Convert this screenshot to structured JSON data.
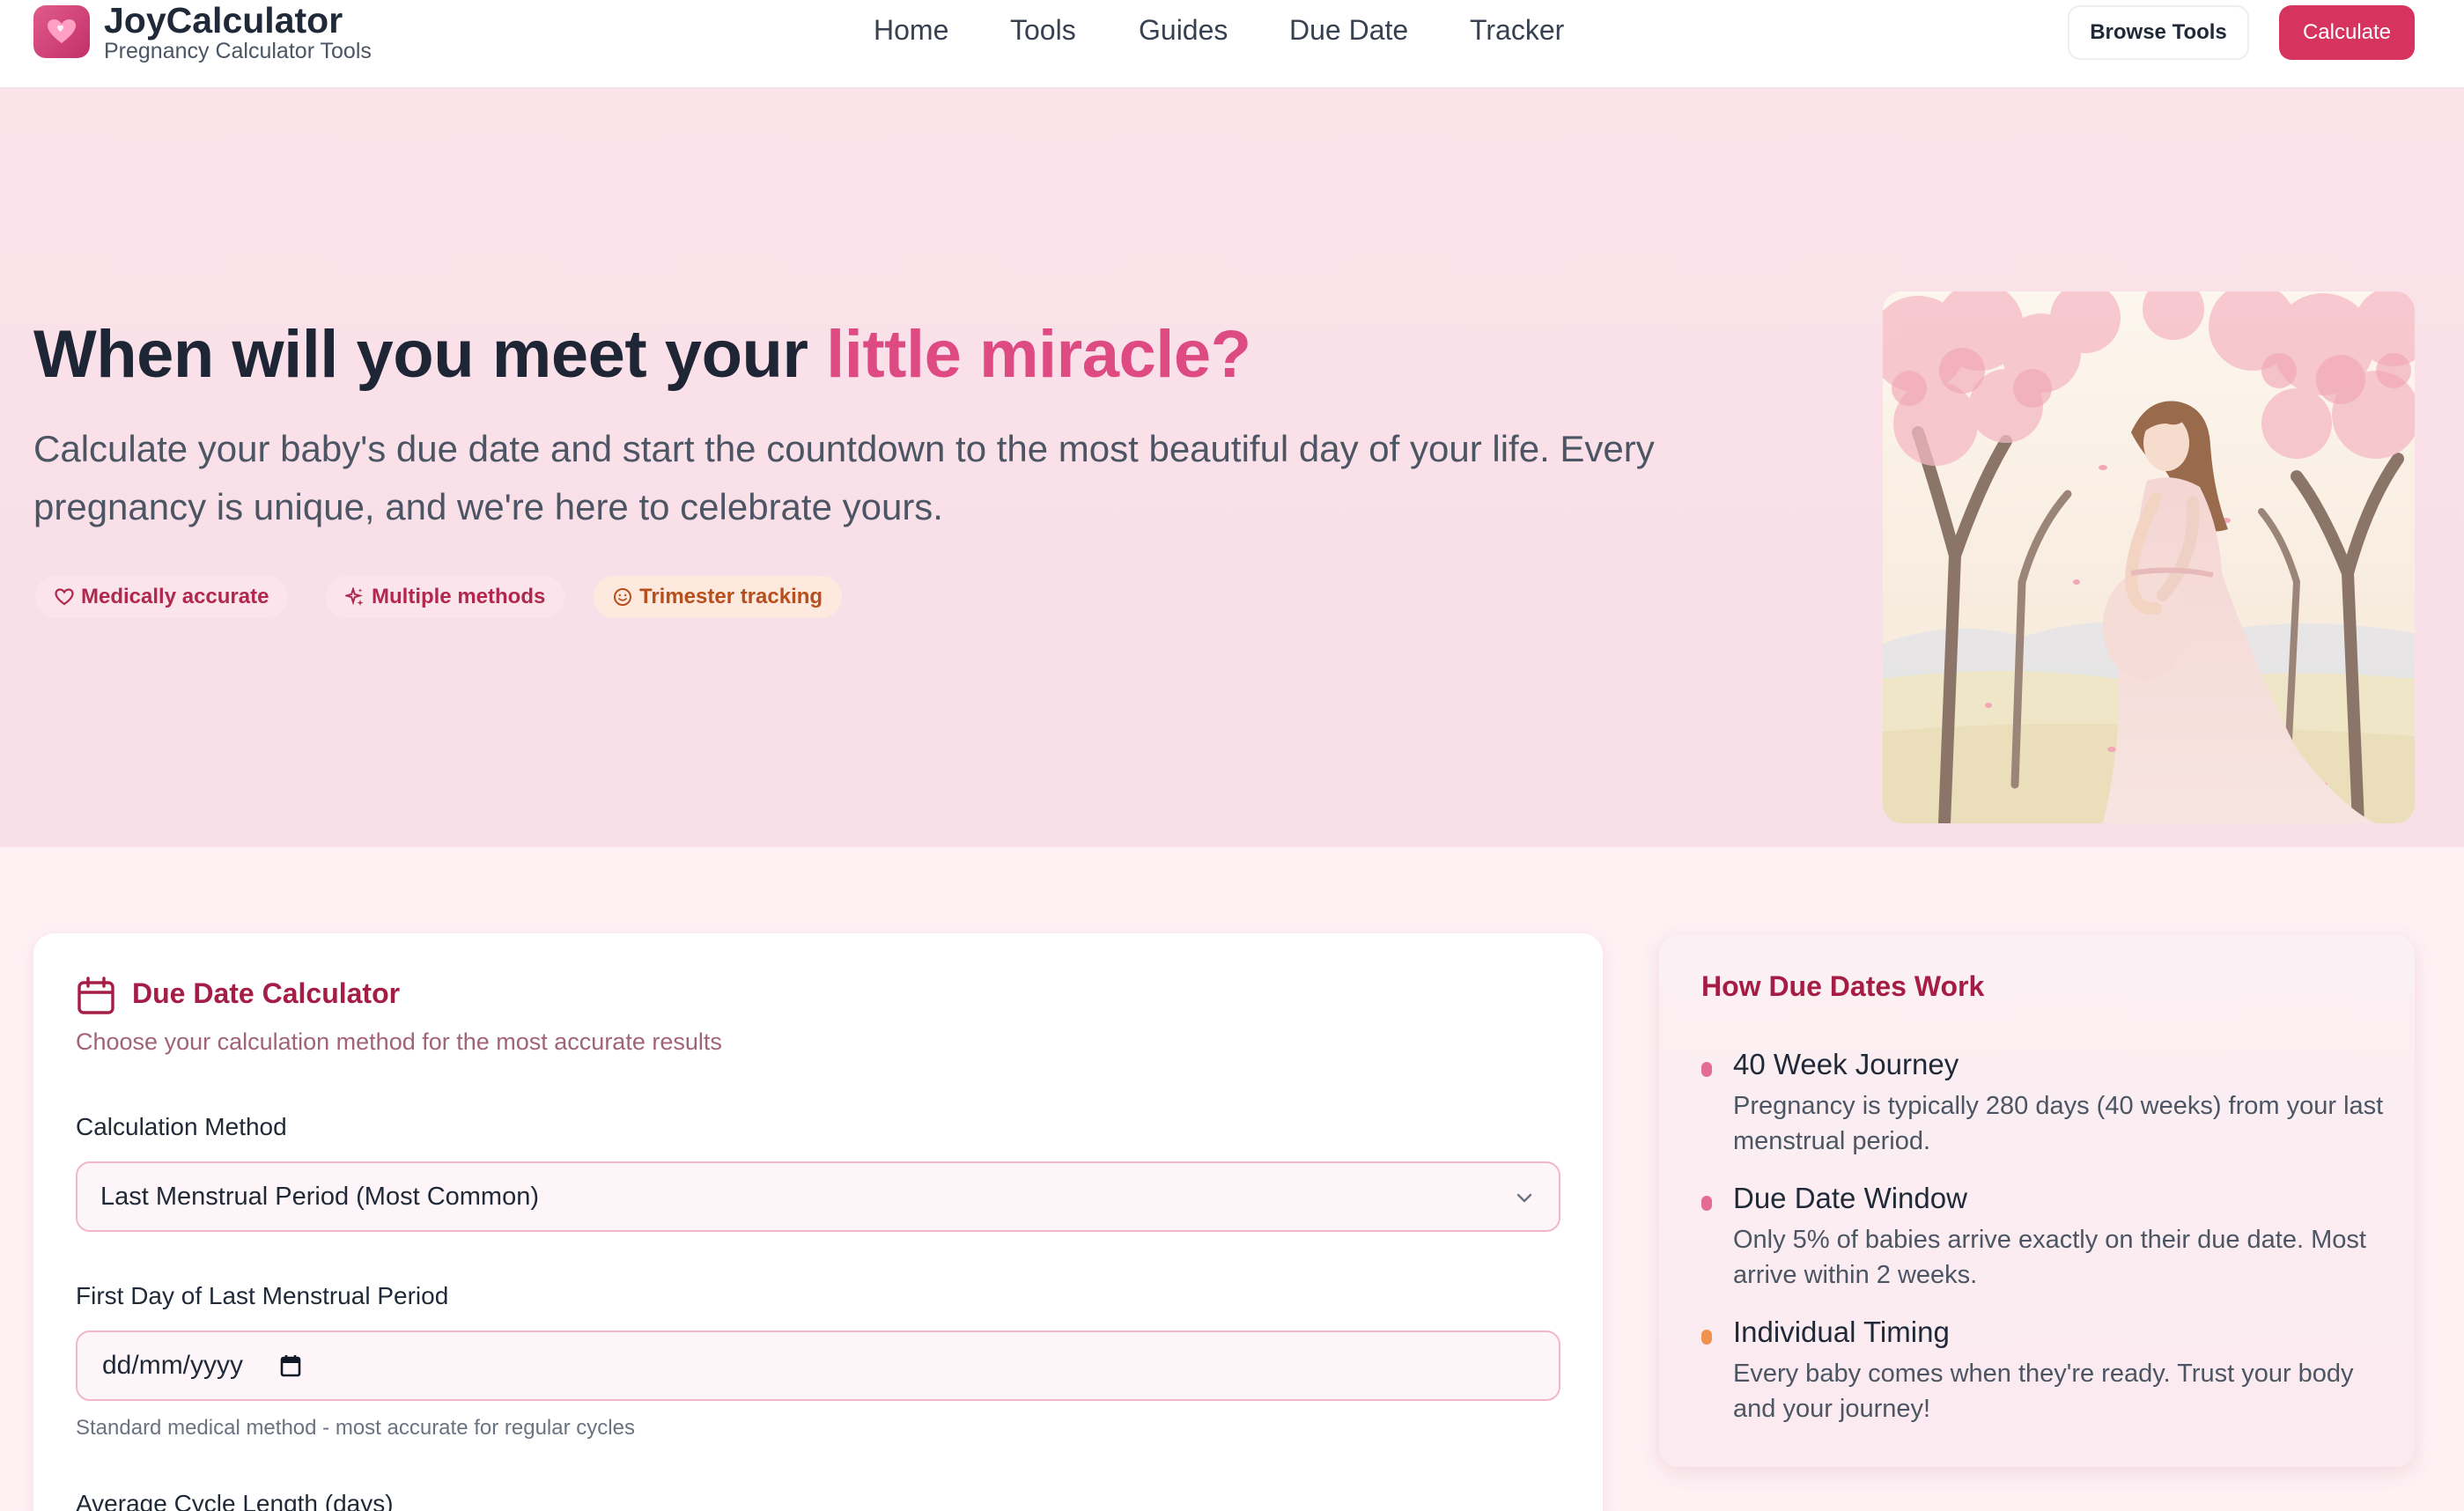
{
  "brand": {
    "name": "JoyCalculator",
    "tagline": "Pregnancy Calculator Tools",
    "logo_icon": "heart-icon"
  },
  "nav": {
    "items": [
      {
        "label": "Home"
      },
      {
        "label": "Tools"
      },
      {
        "label": "Guides"
      },
      {
        "label": "Due Date"
      },
      {
        "label": "Tracker"
      }
    ],
    "browse_label": "Browse Tools",
    "calculate_label": "Calculate"
  },
  "hero": {
    "title_main": "When will you meet your ",
    "title_accent": "little miracle?",
    "description": "Calculate your baby's due date and start the countdown to the most beautiful day of your life. Every pregnancy is unique, and we're here to celebrate yours.",
    "badges": [
      {
        "label": "Medically accurate",
        "icon": "heart-icon"
      },
      {
        "label": "Multiple methods",
        "icon": "sparkle-icon"
      },
      {
        "label": "Trimester tracking",
        "icon": "smile-icon"
      }
    ]
  },
  "calculator": {
    "title": "Due Date Calculator",
    "subtitle": "Choose your calculation method for the most accurate results",
    "method_label": "Calculation Method",
    "method_value": "Last Menstrual Period (Most Common)",
    "date_label": "First Day of Last Menstrual Period",
    "date_placeholder": "dd/mm/yyyy",
    "date_hint": "Standard medical method - most accurate for regular cycles",
    "cycle_label": "Average Cycle Length (days)"
  },
  "info": {
    "title": "How Due Dates Work",
    "items": [
      {
        "title": "40 Week Journey",
        "desc": "Pregnancy is typically 280 days (40 weeks) from your last menstrual period.",
        "color": "#e46b96"
      },
      {
        "title": "Due Date Window",
        "desc": "Only 5% of babies arrive exactly on their due date. Most arrive within 2 weeks.",
        "color": "#e46b96"
      },
      {
        "title": "Individual Timing",
        "desc": "Every baby comes when they're ready. Trust your body and your journey!",
        "color": "#f0924e"
      }
    ]
  },
  "colors": {
    "primary": "#d6335f",
    "accent_text": "#de4b83",
    "heading_dark": "#1e2535",
    "card_title": "#a51d47"
  }
}
